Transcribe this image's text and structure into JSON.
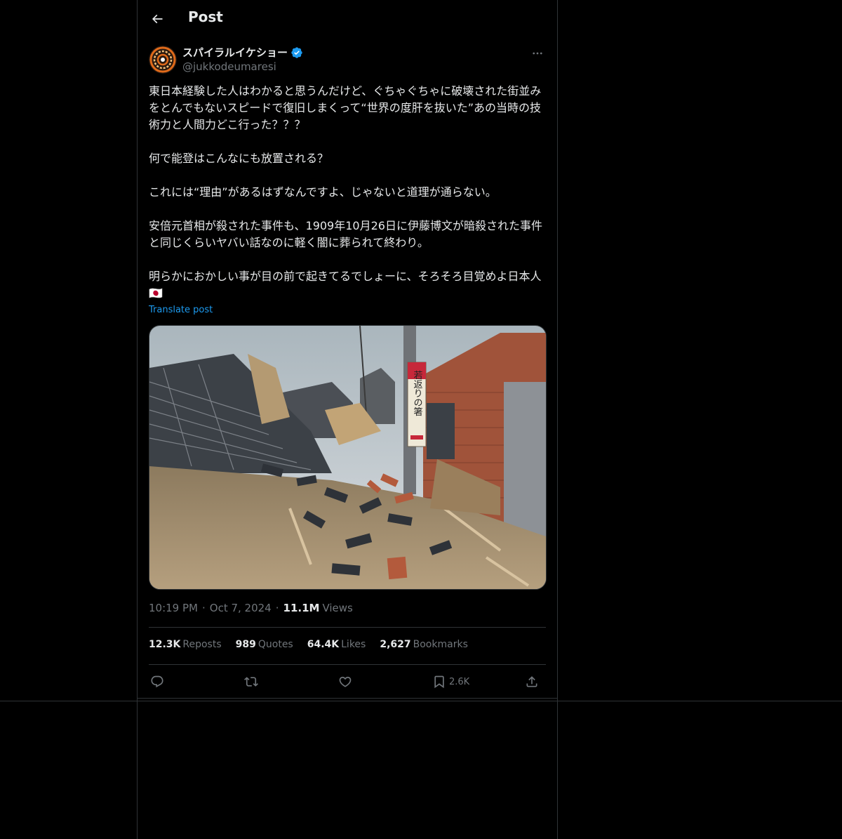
{
  "header": {
    "title": "Post"
  },
  "author": {
    "display_name": "スパイラルイケショー",
    "handle": "@jukkodeumaresi",
    "verified": true
  },
  "post": {
    "text": "東日本経験した人はわかると思うんだけど、ぐちゃぐちゃに破壊された街並みをとんでもないスピードで復旧しまくって“世界の度肝を抜いた”あの当時の技術力と人間力どこ行った？？？\n\n何で能登はこんなにも放置される？\n\nこれには“理由”があるはずなんですよ、じゃないと道理が通らない。\n\n安倍元首相が殺された事件も、1909年10月26日に伊藤博文が暗殺された事件と同じくらいヤバい話なのに軽く闇に葬られて終わり。\n\n明らかにおかしい事が目の前で起きてるでしょーに、そろそろ目覚めよ日本人🇯🇵",
    "translate_label": "Translate post",
    "media_sign_text": "若返りの箸"
  },
  "meta": {
    "time": "10:19 PM",
    "date": "Oct 7, 2024",
    "views_count": "11.1M",
    "views_label": "Views"
  },
  "stats": {
    "reposts_count": "12.3K",
    "reposts_label": "Reposts",
    "quotes_count": "989",
    "quotes_label": "Quotes",
    "likes_count": "64.4K",
    "likes_label": "Likes",
    "bookmarks_count": "2,627",
    "bookmarks_label": "Bookmarks"
  },
  "actions": {
    "bookmark_count": "2.6K"
  },
  "colors": {
    "background": "#000000",
    "text": "#e7e9ea",
    "secondary": "#71767b",
    "accent": "#1d9bf0",
    "border": "#2f3336"
  },
  "icons": [
    "back-arrow-icon",
    "verified-badge-icon",
    "more-icon",
    "reply-icon",
    "repost-icon",
    "like-icon",
    "bookmark-icon",
    "share-icon"
  ]
}
